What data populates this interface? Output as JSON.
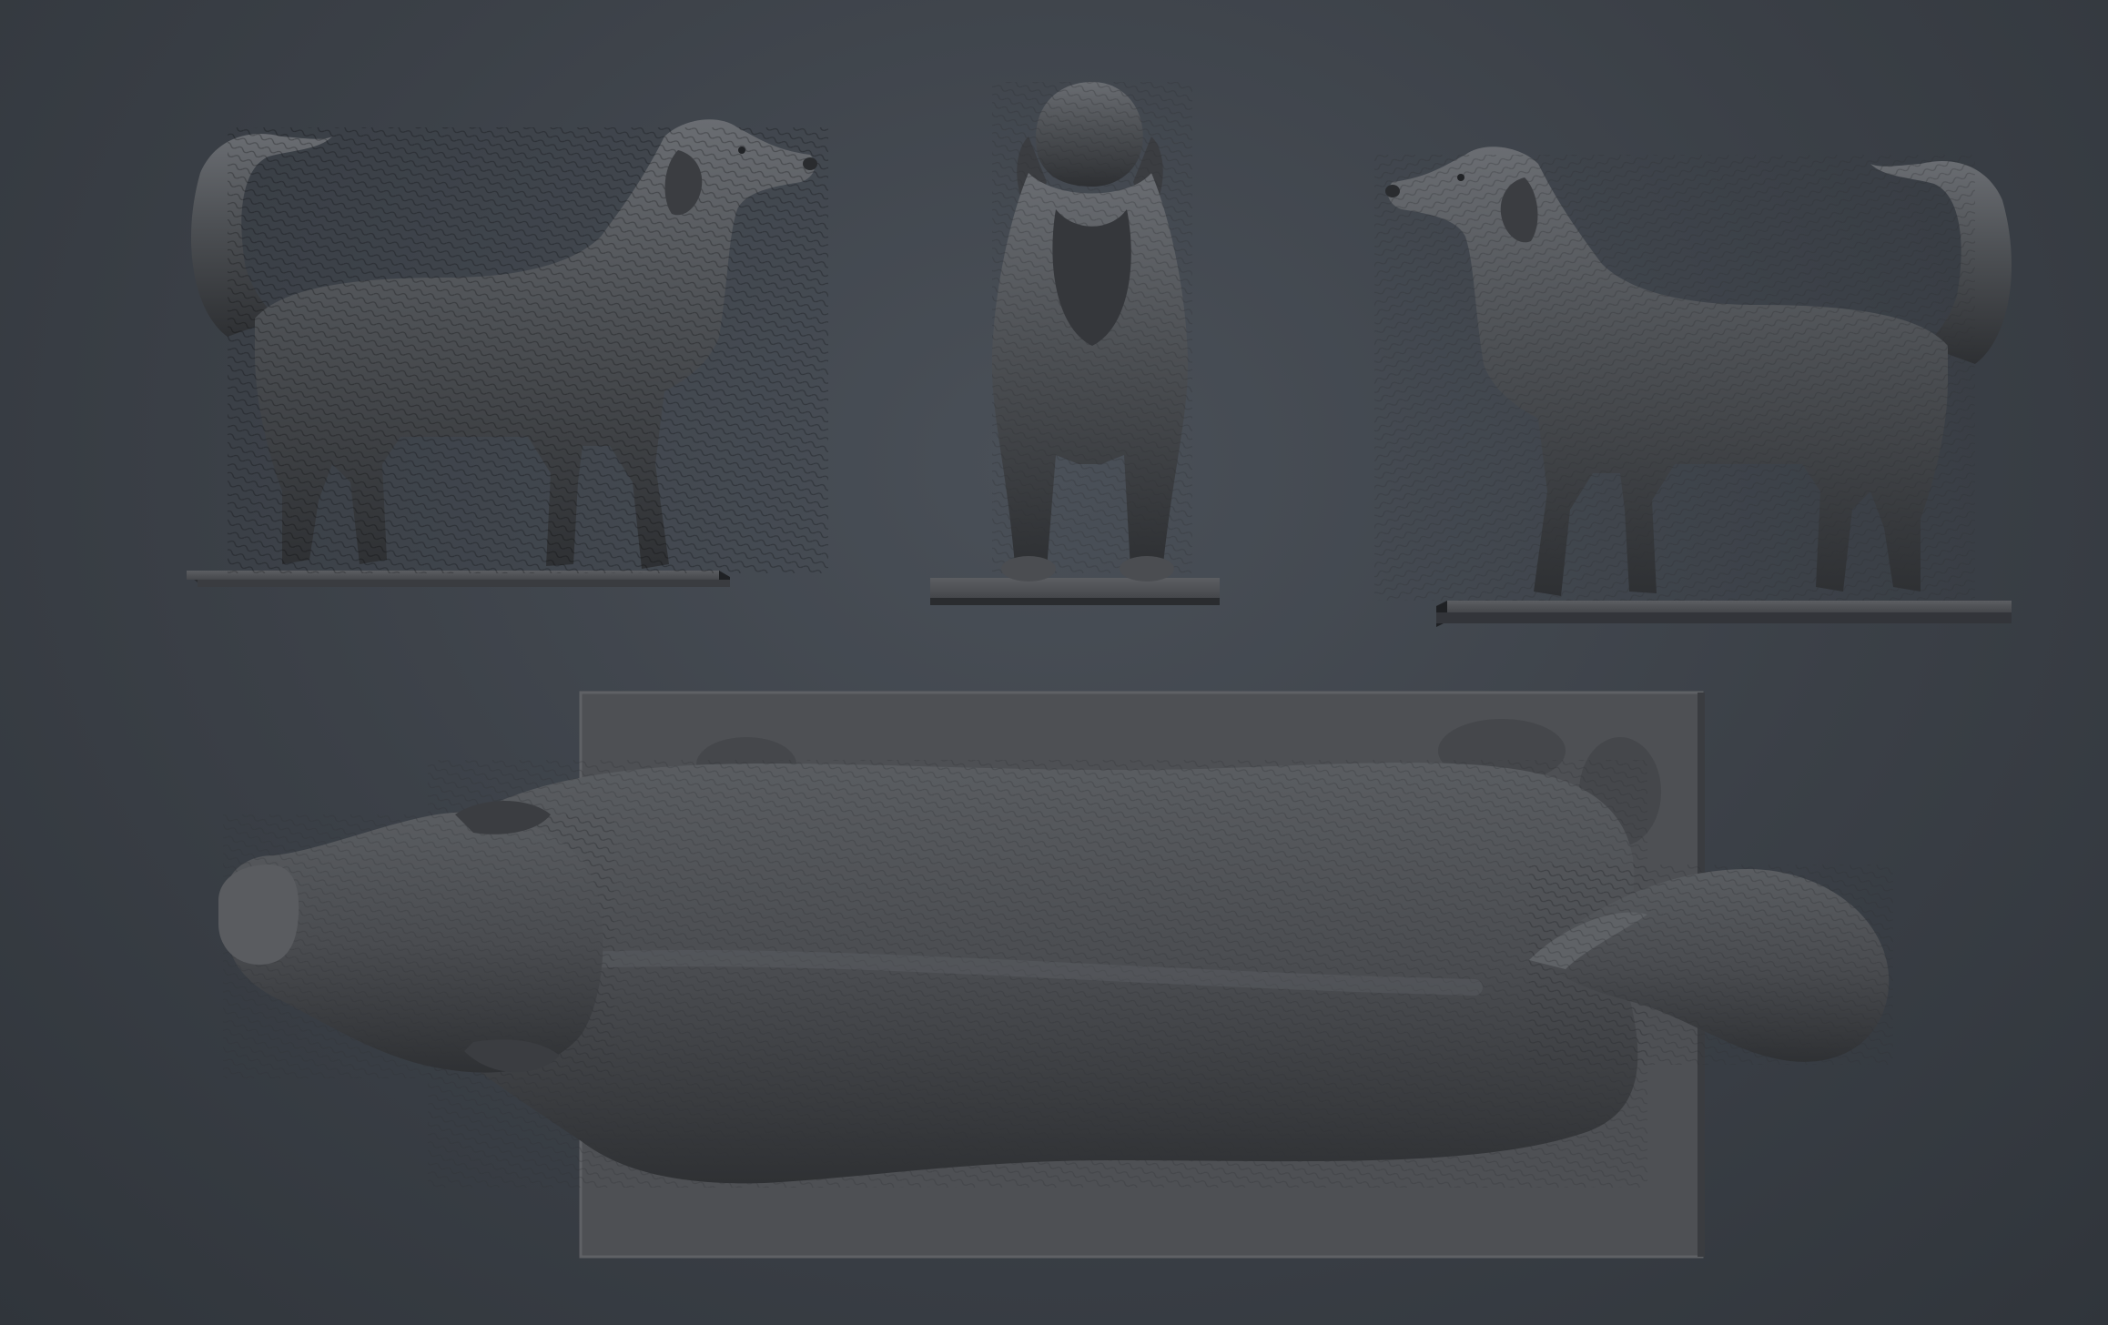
{
  "scene": {
    "background_color": "#3b4047",
    "model_color": "#4a4c50",
    "model_highlight": "#6a6d72",
    "model_shadow": "#2a2c2f",
    "base_color": "#505256",
    "subject": "dog-sculpt-icon"
  },
  "views": [
    {
      "name": "side-right-view"
    },
    {
      "name": "front-view"
    },
    {
      "name": "side-left-view"
    },
    {
      "name": "top-view"
    }
  ]
}
